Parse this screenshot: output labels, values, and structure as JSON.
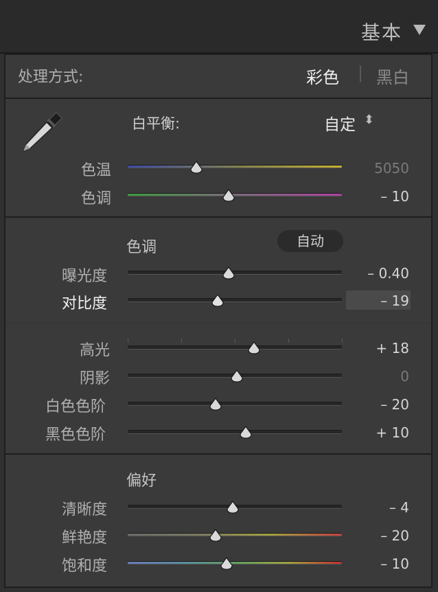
{
  "header": {
    "title": "基本"
  },
  "treatment": {
    "label": "处理方式:",
    "color": "彩色",
    "separator": "|",
    "bw": "黑白"
  },
  "white_balance": {
    "label": "白平衡:",
    "value": "自定",
    "arrows": "⬍"
  },
  "sliders": {
    "temp": {
      "label": "色温",
      "value": "5050",
      "position": 0.32
    },
    "tint": {
      "label": "色调",
      "value": "– 10",
      "position": 0.47
    },
    "exposure": {
      "label": "曝光度",
      "value": "– 0.40",
      "position": 0.47
    },
    "contrast": {
      "label": "对比度",
      "value": "– 19",
      "position": 0.42
    },
    "highlights": {
      "label": "高光",
      "value": "+ 18",
      "position": 0.59
    },
    "shadows": {
      "label": "阴影",
      "value": "0",
      "position": 0.51
    },
    "whites": {
      "label": "白色色阶",
      "value": "– 20",
      "position": 0.41
    },
    "blacks": {
      "label": "黑色色阶",
      "value": "+ 10",
      "position": 0.55
    },
    "clarity": {
      "label": "清晰度",
      "value": "– 4",
      "position": 0.49
    },
    "vibrance": {
      "label": "鲜艳度",
      "value": "– 20",
      "position": 0.41
    },
    "saturation": {
      "label": "饱和度",
      "value": "– 10",
      "position": 0.46
    }
  },
  "tone": {
    "label": "色调",
    "auto": "自动"
  },
  "presence": {
    "label": "偏好"
  },
  "colors": {
    "background": "#3a3a3a",
    "temp_gradient": [
      "#3b4aa8",
      "#8a8a40",
      "#c8b030"
    ],
    "tint_gradient": [
      "#3c9a3c",
      "#8a6a8a",
      "#b040a0"
    ],
    "vibrance_gradient": [
      "#707070",
      "#a0a040",
      "#c04040"
    ],
    "saturation_gradient": [
      "#7080c0",
      "#60a060",
      "#c03030"
    ]
  }
}
